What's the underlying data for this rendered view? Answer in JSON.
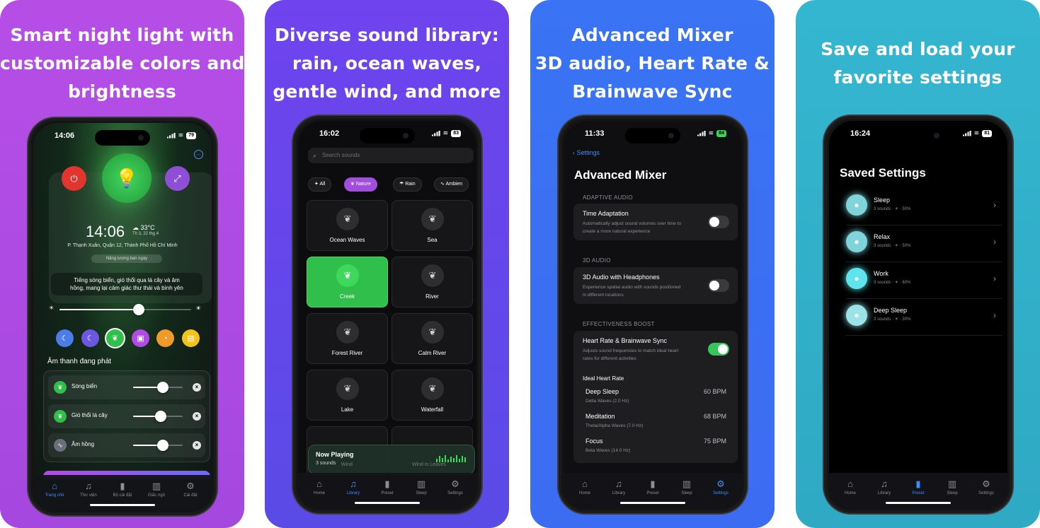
{
  "panel1": {
    "headline": [
      "Smart night light with",
      "customizable colors and",
      "brightness"
    ],
    "status": {
      "time": "14:06",
      "battery": "79"
    },
    "clock": "14:06",
    "weather_temp": "33°C",
    "weather_date": "Th 3, 22 thg 4",
    "address": "P. Thạnh Xuân, Quận 12, Thành Phố Hồ Chí Minh",
    "energy_pill": "Năng lượng ban ngày",
    "quote": [
      "Tiếng sóng biển, gió thổi qua lá cây và âm",
      "hồng, mang lại cảm giác thư thái và bình yên"
    ],
    "brightness_level": 0.6,
    "section_title": "Âm thanh đang phát",
    "sounds": [
      {
        "name": "Sóng biển",
        "level": 0.6
      },
      {
        "name": "Gió thổi lá cây",
        "level": 0.55
      },
      {
        "name": "Âm hồng",
        "level": 0.6
      }
    ],
    "tabs": [
      "Trang chủ",
      "Thư viện",
      "Bộ cài đặt",
      "Giấc ngủ",
      "Cài đặt"
    ],
    "colors": {
      "power": "#e2352f",
      "bulb": "#2fbf4a",
      "expand": "#8e4fd6"
    }
  },
  "panel2": {
    "headline": [
      "Diverse sound library:",
      "rain, ocean waves,",
      "gentle wind, and more"
    ],
    "status": {
      "time": "16:02",
      "battery": "83"
    },
    "search_placeholder": "Search sounds",
    "chips": [
      "All",
      "Nature",
      "Rain",
      "Ambien"
    ],
    "tiles": [
      "Ocean Waves",
      "Sea",
      "Creek",
      "River",
      "Forest River",
      "Calm River",
      "Lake",
      "Waterfall"
    ],
    "now_playing": {
      "title": "Now Playing",
      "count": "3 sounds",
      "item1": "Wind",
      "item2": "Wind in Leaves"
    },
    "tabs": [
      "Home",
      "Library",
      "Preset",
      "Sleep",
      "Settings"
    ]
  },
  "panel3": {
    "headline": [
      "Advanced Mixer",
      "3D audio, Heart Rate &",
      "Brainwave Sync"
    ],
    "status": {
      "time": "11:33",
      "battery": "84"
    },
    "back": "Settings",
    "title": "Advanced Mixer",
    "sections": {
      "adaptive": {
        "caption": "ADAPTIVE AUDIO",
        "name": "Time Adaptation",
        "desc": [
          "Automatically adjust sound volumes over time to",
          "create a more natural experience"
        ]
      },
      "audio3d": {
        "caption": "3D AUDIO",
        "name": "3D Audio with Headphones",
        "desc": [
          "Experience spatial audio with sounds positioned",
          "in different locations"
        ]
      },
      "boost": {
        "caption": "EFFECTIVENESS BOOST",
        "name": "Heart Rate & Brainwave Sync",
        "desc": [
          "Adjusts sound frequencies to match ideal heart",
          "rates for different activities"
        ]
      }
    },
    "ideal_title": "Ideal Heart Rate",
    "rates": [
      {
        "name": "Deep Sleep",
        "wave": "Delta Waves (2.0 Hz)",
        "bpm": "60 BPM"
      },
      {
        "name": "Meditation",
        "wave": "Theta/Alpha Waves (7.0 Hz)",
        "bpm": "68 BPM"
      },
      {
        "name": "Focus",
        "wave": "Beta Waves (14.0 Hz)",
        "bpm": "75 BPM"
      }
    ],
    "tabs": [
      "Home",
      "Library",
      "Preset",
      "Sleep",
      "Settings"
    ]
  },
  "panel4": {
    "headline": [
      "Save and load your",
      "favorite settings"
    ],
    "status": {
      "time": "16:24",
      "battery": "81"
    },
    "title": "Saved Settings",
    "presets": [
      {
        "name": "Sleep",
        "meta": "3 sounds · ☀ · 50%",
        "color": "#7fd4da"
      },
      {
        "name": "Relax",
        "meta": "3 sounds · ☀ · 50%",
        "color": "#7fd4da"
      },
      {
        "name": "Work",
        "meta": "3 sounds · ☀ · 60%",
        "color": "#5fe3ec"
      },
      {
        "name": "Deep Sleep",
        "meta": "3 sounds · ☀ · 30%",
        "color": "#9be3e8"
      }
    ],
    "tabs": [
      "Home",
      "Library",
      "Preset",
      "Sleep",
      "Settings"
    ]
  }
}
